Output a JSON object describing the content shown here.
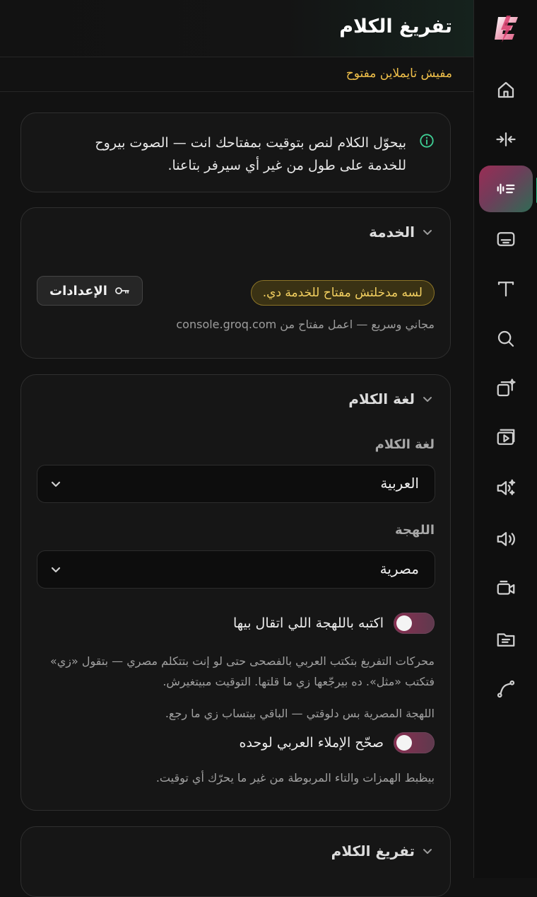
{
  "header": {
    "title": "تفريغ الكلام"
  },
  "subbar": {
    "status": "مفيش تايملاين مفتوح"
  },
  "info": {
    "text": "بيحوّل الكلام لنص بتوقيت بمفتاحك انت — الصوت بيروح للخدمة على طول من غير أي سيرفر بتاعنا."
  },
  "service": {
    "heading": "الخدمة",
    "warning": "لسه مدخلتش مفتاح للخدمة دي.",
    "settings_label": "الإعدادات",
    "hint": "مجاني وسريع — اعمل مفتاح من console.groq.com"
  },
  "language": {
    "heading": "لغة الكلام",
    "language_label": "لغة الكلام",
    "language_value": "العربية",
    "dialect_label": "اللهجة",
    "dialect_value": "مصرية",
    "toggle_dialect_label": "اكتبه باللهجة اللي اتقال بيها",
    "toggle_dialect_on": false,
    "dialect_desc": "محركات التفريغ بتكتب العربي بالفصحى حتى لو إنت بتتكلم مصري — بتقول «زي» فتكتب «مثل». ده بيرجّعها زي ما قلتها. التوقيت مبيتغيرش.",
    "dialect_note": "اللهجة المصرية بس دلوقتي — الباقي بيتساب زي ما رجع.",
    "toggle_spell_label": "صحّح الإملاء العربي لوحده",
    "toggle_spell_on": false,
    "spell_desc": "بيظبط الهمزات والتاء المربوطة من غير ما يحرّك أي توقيت."
  },
  "transcribe": {
    "heading": "تفريغ الكلام"
  },
  "sidebar": {
    "items": [
      {
        "icon": "home-icon"
      },
      {
        "icon": "split-icon"
      },
      {
        "icon": "transcribe-icon",
        "active": true
      },
      {
        "icon": "subtitles-icon"
      },
      {
        "icon": "text-icon"
      },
      {
        "icon": "search-icon"
      },
      {
        "icon": "ai-clone-icon"
      },
      {
        "icon": "video-play-icon"
      },
      {
        "icon": "ai-voice-icon"
      },
      {
        "icon": "speaker-icon"
      },
      {
        "icon": "camera-icon"
      },
      {
        "icon": "folder-icon"
      },
      {
        "icon": "curve-icon"
      }
    ]
  },
  "colors": {
    "accent_warning": "#f0c04a",
    "active_rail": "#2fbf88",
    "toggle": "#8a2d50"
  }
}
